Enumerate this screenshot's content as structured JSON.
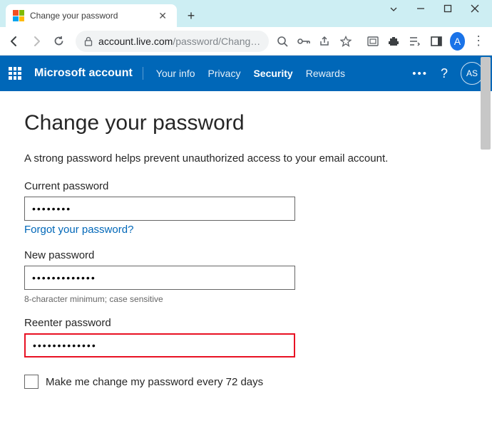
{
  "browser": {
    "tab_title": "Change your password",
    "url_host": "account.live.com",
    "url_path": "/password/Chang…",
    "avatar_letter": "A"
  },
  "header": {
    "brand": "Microsoft account",
    "nav": {
      "your_info": "Your info",
      "privacy": "Privacy",
      "security": "Security",
      "rewards": "Rewards"
    },
    "avatar_initials": "AS"
  },
  "page": {
    "title": "Change your password",
    "subtitle": "A strong password helps prevent unauthorized access to your email account.",
    "current_label": "Current password",
    "current_value": "••••••••",
    "forgot_link": "Forgot your password?",
    "new_label": "New password",
    "new_value": "•••••••••••••",
    "hint": "8-character minimum; case sensitive",
    "reenter_label": "Reenter password",
    "reenter_value": "•••••••••••••",
    "checkbox_label": "Make me change my password every 72 days"
  }
}
